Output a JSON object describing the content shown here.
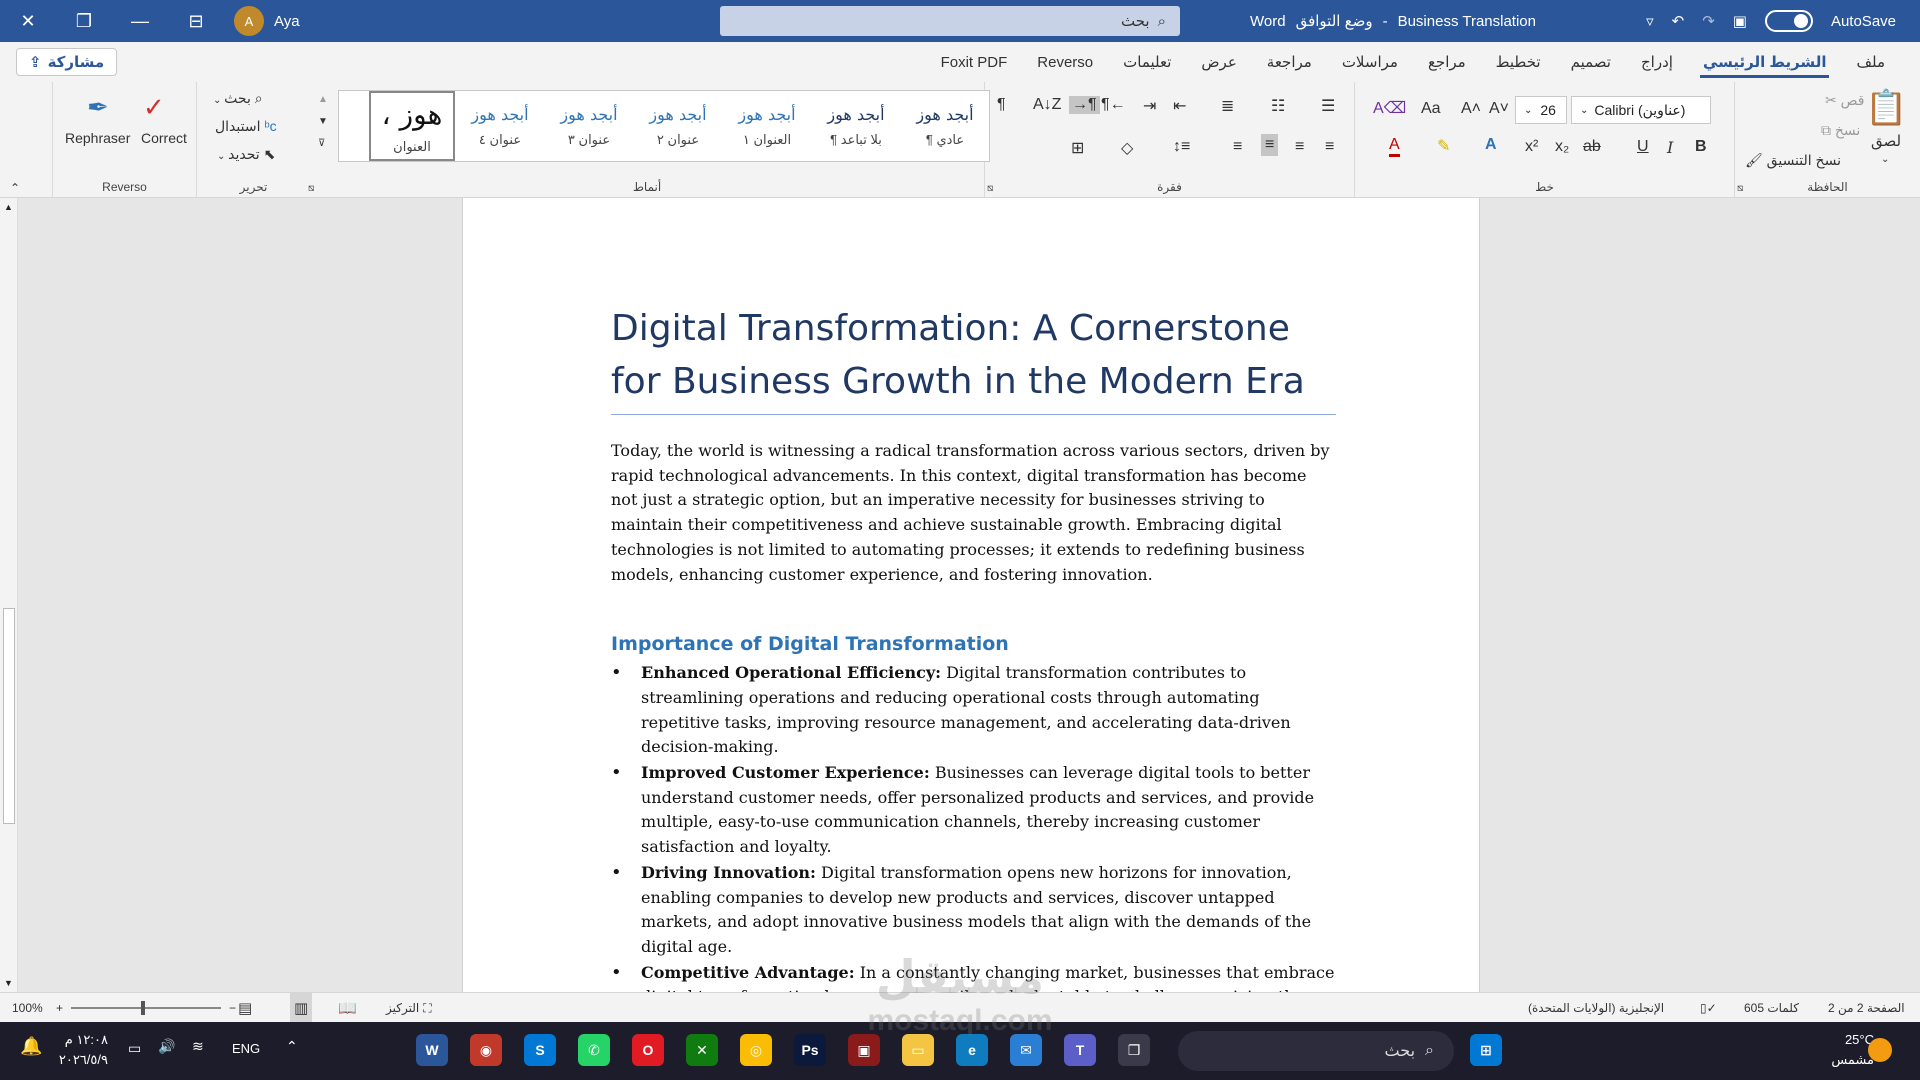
{
  "titlebar": {
    "user_initial": "A",
    "user_name": "Aya",
    "search_placeholder": "بحث",
    "app": "Word",
    "separator": "-",
    "mode": "وضع التوافق",
    "doc_name": "Business Translation",
    "autosave": "AutoSave"
  },
  "tabs": {
    "share": "مشاركة",
    "items": [
      "ملف",
      "الشريط الرئيسي",
      "إدراج",
      "تصميم",
      "تخطيط",
      "مراجع",
      "مراسلات",
      "مراجعة",
      "عرض",
      "تعليمات",
      "Reverso",
      "Foxit PDF"
    ],
    "active_index": 1
  },
  "ribbon": {
    "clipboard": {
      "paste": "لصق",
      "cut": "قص",
      "copy": "نسخ",
      "format_painter": "نسخ التنسيق",
      "label": "الحافظة"
    },
    "font": {
      "name": "Calibri (عناوين)",
      "size": "26",
      "label": "خط",
      "bold": "B",
      "italic": "I",
      "underline": "U",
      "strike": "ab",
      "sub": "x₂",
      "sup": "x²",
      "grow": "A˄",
      "shrink": "A˅",
      "case": "Aa"
    },
    "paragraph": {
      "label": "فقرة"
    },
    "styles": {
      "label": "أنماط",
      "items": [
        {
          "sample": "أبجد هوز",
          "name": "¶ عادي"
        },
        {
          "sample": "أبجد هوز",
          "name": "¶ بلا تباعد"
        },
        {
          "sample": "أبجد هوز",
          "name": "العنوان ١"
        },
        {
          "sample": "أبجد هوز",
          "name": "عنوان ٢"
        },
        {
          "sample": "أبجد هوز",
          "name": "عنوان ٣"
        },
        {
          "sample": "أبجد هوز",
          "name": "عنوان ٤"
        },
        {
          "sample": "، هوز",
          "name": "العنوان"
        }
      ]
    },
    "editing": {
      "find": "بحث",
      "replace": "استبدال",
      "select": "تحديد",
      "label": "تحرير"
    },
    "reverso": {
      "rephraser": "Rephraser",
      "correct": "Correct",
      "label": "Reverso"
    }
  },
  "document": {
    "title": "Digital Transformation: A Cornerstone for Business Growth in the Modern Era",
    "intro": "Today, the world is witnessing a radical transformation across various sectors, driven by rapid technological advancements. In this context, digital transformation has become not just a strategic option, but an imperative necessity for businesses striving to maintain their competitiveness and achieve sustainable growth. Embracing digital technologies is not limited to automating processes; it extends to redefining business models, enhancing customer experience, and fostering innovation.",
    "heading": "Importance of Digital Transformation",
    "bullets": [
      {
        "bold": "Enhanced Operational Efficiency:",
        "text": " Digital transformation contributes to streamlining operations and reducing operational costs through automating repetitive tasks, improving resource management, and accelerating data-driven decision-making."
      },
      {
        "bold": "Improved Customer Experience:",
        "text": " Businesses can leverage digital tools to better understand customer needs, offer personalized products and services, and provide multiple, easy-to-use communication channels, thereby increasing customer satisfaction and loyalty."
      },
      {
        "bold": "Driving Innovation:",
        "text": " Digital transformation opens new horizons for innovation, enabling companies to develop new products and services, discover untapped markets, and adopt innovative business models that align with the demands of the digital age."
      },
      {
        "bold": "Competitive Advantage:",
        "text": " In a constantly changing market, businesses that embrace digital transformation become more agile and adaptable to challenges, giving them a clear competitive edge over their rivals."
      }
    ]
  },
  "statusbar": {
    "zoom": "100%",
    "focus": "التركيز",
    "language": "الإنجليزية (الولايات المتحدة)",
    "words": "605 كلمات",
    "page": "الصفحة 2 من 2"
  },
  "taskbar": {
    "search": "بحث",
    "weather_temp": "25°C",
    "weather_desc": "مشمس",
    "lang": "ENG",
    "time": "١٢:٠٨ م",
    "date": "٢٠٢٦/٥/٩",
    "apps": [
      {
        "name": "word",
        "glyph": "W",
        "color": "#2b579a"
      },
      {
        "name": "app-red",
        "glyph": "◉",
        "color": "#c0392b"
      },
      {
        "name": "skype",
        "glyph": "S",
        "color": "#0078d4"
      },
      {
        "name": "whatsapp",
        "glyph": "✆",
        "color": "#25d366"
      },
      {
        "name": "opera",
        "glyph": "O",
        "color": "#e01b24"
      },
      {
        "name": "xbox",
        "glyph": "✕",
        "color": "#107c10"
      },
      {
        "name": "chrome",
        "glyph": "◎",
        "color": "#fbbc05"
      },
      {
        "name": "photoshop",
        "glyph": "Ps",
        "color": "#0b1a3c"
      },
      {
        "name": "app-maroon",
        "glyph": "▣",
        "color": "#8b1a1a"
      },
      {
        "name": "file-explorer",
        "glyph": "▭",
        "color": "#f4c542"
      },
      {
        "name": "edge",
        "glyph": "e",
        "color": "#0f7cbf"
      },
      {
        "name": "mail",
        "glyph": "✉",
        "color": "#2a7fd4"
      },
      {
        "name": "teams",
        "glyph": "T",
        "color": "#5b5fc7"
      },
      {
        "name": "task-view",
        "glyph": "❐",
        "color": "#3a3a4a"
      }
    ],
    "watermark_top": "مستقل",
    "watermark_bottom": "mostaql.com"
  }
}
